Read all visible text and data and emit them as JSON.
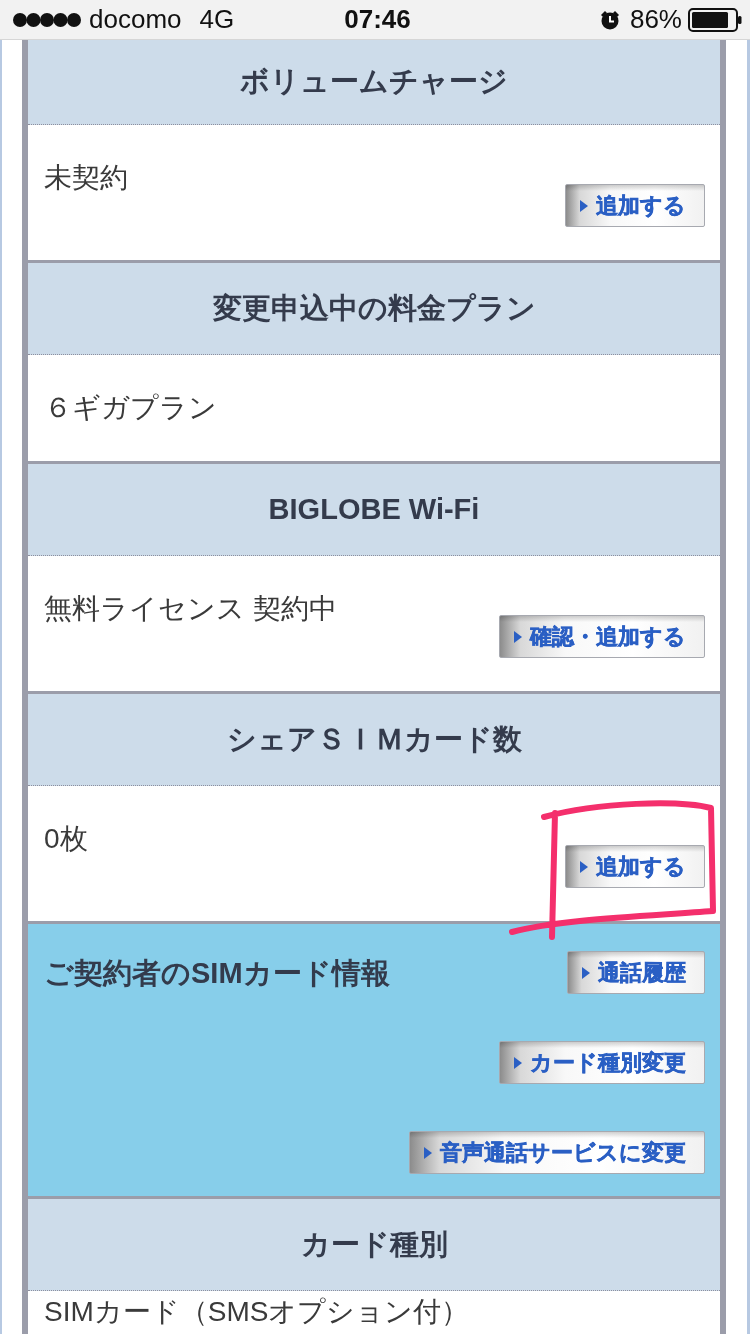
{
  "status_bar": {
    "carrier": "docomo",
    "network": "4G",
    "time": "07:46",
    "battery": "86%"
  },
  "sections": [
    {
      "kind": "value",
      "title": "ボリュームチャージ",
      "value": "未契約",
      "buttons": [
        {
          "label": "追加する"
        }
      ],
      "highlighted": false
    },
    {
      "kind": "value",
      "title": "変更申込中の料金プラン",
      "value": "６ギガプラン",
      "highlighted": false
    },
    {
      "kind": "value",
      "title": "BIGLOBE Wi-Fi",
      "value": "無料ライセンス 契約中",
      "buttons": [
        {
          "label": "確認・追加する"
        }
      ],
      "highlighted": false
    },
    {
      "kind": "value",
      "title": "シェアＳＩＭカード数",
      "value": "0枚",
      "buttons": [
        {
          "label": "追加する"
        }
      ],
      "highlighted": true
    },
    {
      "kind": "actions",
      "title": "ご契約者のSIMカード情報",
      "buttons": [
        {
          "label": "通話履歴"
        },
        {
          "label": "カード種別変更"
        },
        {
          "label": "音声通話サービスに変更"
        }
      ],
      "highlighted": false
    },
    {
      "kind": "value",
      "title": "カード種別",
      "value": "SIMカード（SMSオプション付）",
      "highlighted": false
    }
  ]
}
